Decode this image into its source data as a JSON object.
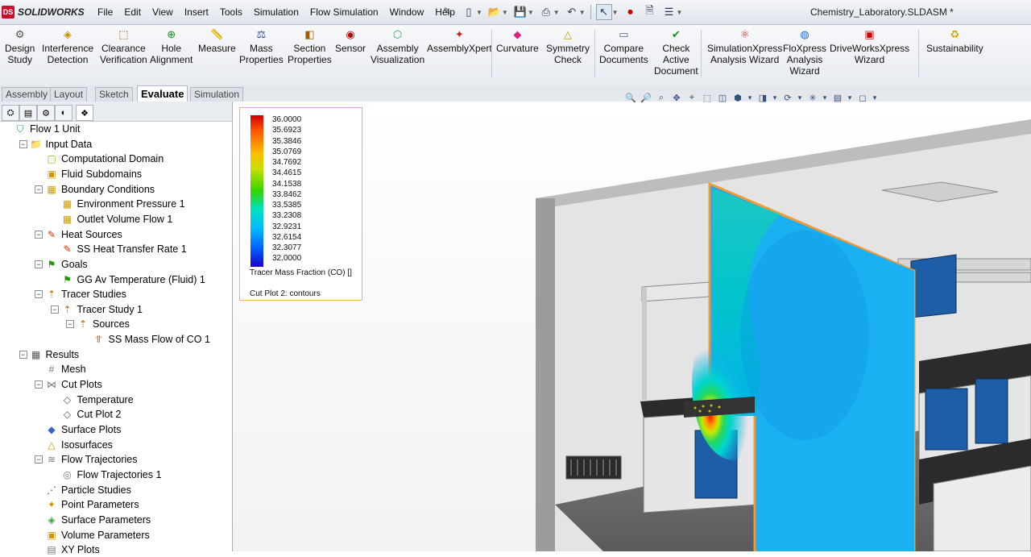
{
  "app": {
    "logo_mark": "DS",
    "name": "SOLIDWORKS",
    "document_title": "Chemistry_Laboratory.SLDASM *"
  },
  "menus": [
    "File",
    "Edit",
    "View",
    "Insert",
    "Tools",
    "Simulation",
    "Flow Simulation",
    "Window",
    "Help"
  ],
  "toolbar": [
    {
      "label": "Design\nStudy",
      "icon": "design-study-icon"
    },
    {
      "label": "Interference\nDetection",
      "icon": "interference-icon"
    },
    {
      "label": "Clearance\nVerification",
      "icon": "clearance-icon"
    },
    {
      "label": "Hole\nAlignment",
      "icon": "hole-icon"
    },
    {
      "label": "Measure",
      "icon": "measure-icon"
    },
    {
      "label": "Mass\nProperties",
      "icon": "mass-icon"
    },
    {
      "label": "Section\nProperties",
      "icon": "section-icon"
    },
    {
      "label": "Sensor",
      "icon": "sensor-icon"
    },
    {
      "label": "Assembly\nVisualization",
      "icon": "assembly-vis-icon"
    },
    {
      "label": "AssemblyXpert",
      "icon": "assemblyxpert-icon"
    },
    {
      "label": "Curvature",
      "icon": "curvature-icon"
    },
    {
      "label": "Symmetry\nCheck",
      "icon": "symmetry-icon"
    },
    {
      "label": "Compare\nDocuments",
      "icon": "compare-icon"
    },
    {
      "label": "Check\nActive\nDocument",
      "icon": "check-icon"
    },
    {
      "label": "SimulationXpress\nAnalysis Wizard",
      "icon": "simxpress-icon"
    },
    {
      "label": "FloXpress\nAnalysis\nWizard",
      "icon": "floxpress-icon"
    },
    {
      "label": "DriveWorksXpress\nWizard",
      "icon": "driveworks-icon"
    },
    {
      "label": "Sustainability",
      "icon": "sustainability-icon"
    }
  ],
  "tabs": [
    "Assembly",
    "Layout",
    "Sketch",
    "Evaluate",
    "Simulation"
  ],
  "active_tab": "Evaluate",
  "tree": [
    {
      "label": "Flow 1 Unit",
      "level": 0,
      "toggle": ""
    },
    {
      "label": "Input Data",
      "level": 1,
      "toggle": "−"
    },
    {
      "label": "Computational Domain",
      "level": 2,
      "toggle": ""
    },
    {
      "label": "Fluid Subdomains",
      "level": 2,
      "toggle": ""
    },
    {
      "label": "Boundary Conditions",
      "level": 2,
      "toggle": "−"
    },
    {
      "label": "Environment Pressure 1",
      "level": 3,
      "toggle": ""
    },
    {
      "label": "Outlet Volume Flow 1",
      "level": 3,
      "toggle": ""
    },
    {
      "label": "Heat Sources",
      "level": 2,
      "toggle": "−"
    },
    {
      "label": "SS Heat Transfer Rate 1",
      "level": 3,
      "toggle": ""
    },
    {
      "label": "Goals",
      "level": 2,
      "toggle": "−"
    },
    {
      "label": "GG Av Temperature (Fluid) 1",
      "level": 3,
      "toggle": ""
    },
    {
      "label": "Tracer Studies",
      "level": 2,
      "toggle": "−"
    },
    {
      "label": "Tracer Study 1",
      "level": 3,
      "toggle": "−"
    },
    {
      "label": "Sources",
      "level": 4,
      "toggle": "−"
    },
    {
      "label": "SS Mass Flow of CO 1",
      "level": 5,
      "toggle": ""
    },
    {
      "label": "Results",
      "level": 1,
      "toggle": "−"
    },
    {
      "label": "Mesh",
      "level": 2,
      "toggle": ""
    },
    {
      "label": "Cut Plots",
      "level": 2,
      "toggle": "−"
    },
    {
      "label": "Temperature",
      "level": 3,
      "toggle": ""
    },
    {
      "label": "Cut Plot 2",
      "level": 3,
      "toggle": ""
    },
    {
      "label": "Surface Plots",
      "level": 2,
      "toggle": ""
    },
    {
      "label": "Isosurfaces",
      "level": 2,
      "toggle": ""
    },
    {
      "label": "Flow Trajectories",
      "level": 2,
      "toggle": "−"
    },
    {
      "label": "Flow Trajectories 1",
      "level": 3,
      "toggle": ""
    },
    {
      "label": "Particle Studies",
      "level": 2,
      "toggle": ""
    },
    {
      "label": "Point Parameters",
      "level": 2,
      "toggle": ""
    },
    {
      "label": "Surface Parameters",
      "level": 2,
      "toggle": ""
    },
    {
      "label": "Volume Parameters",
      "level": 2,
      "toggle": ""
    },
    {
      "label": "XY Plots",
      "level": 2,
      "toggle": ""
    }
  ],
  "legend": {
    "values": [
      "36.0000",
      "35.6923",
      "35.3846",
      "35.0769",
      "34.7692",
      "34.4615",
      "34.1538",
      "33.8462",
      "33.5385",
      "33.2308",
      "32.9231",
      "32.6154",
      "32.3077",
      "32.0000"
    ],
    "title": "Tracer Mass Fraction (CO) []",
    "plot_name": "Cut Plot 2: contours"
  }
}
